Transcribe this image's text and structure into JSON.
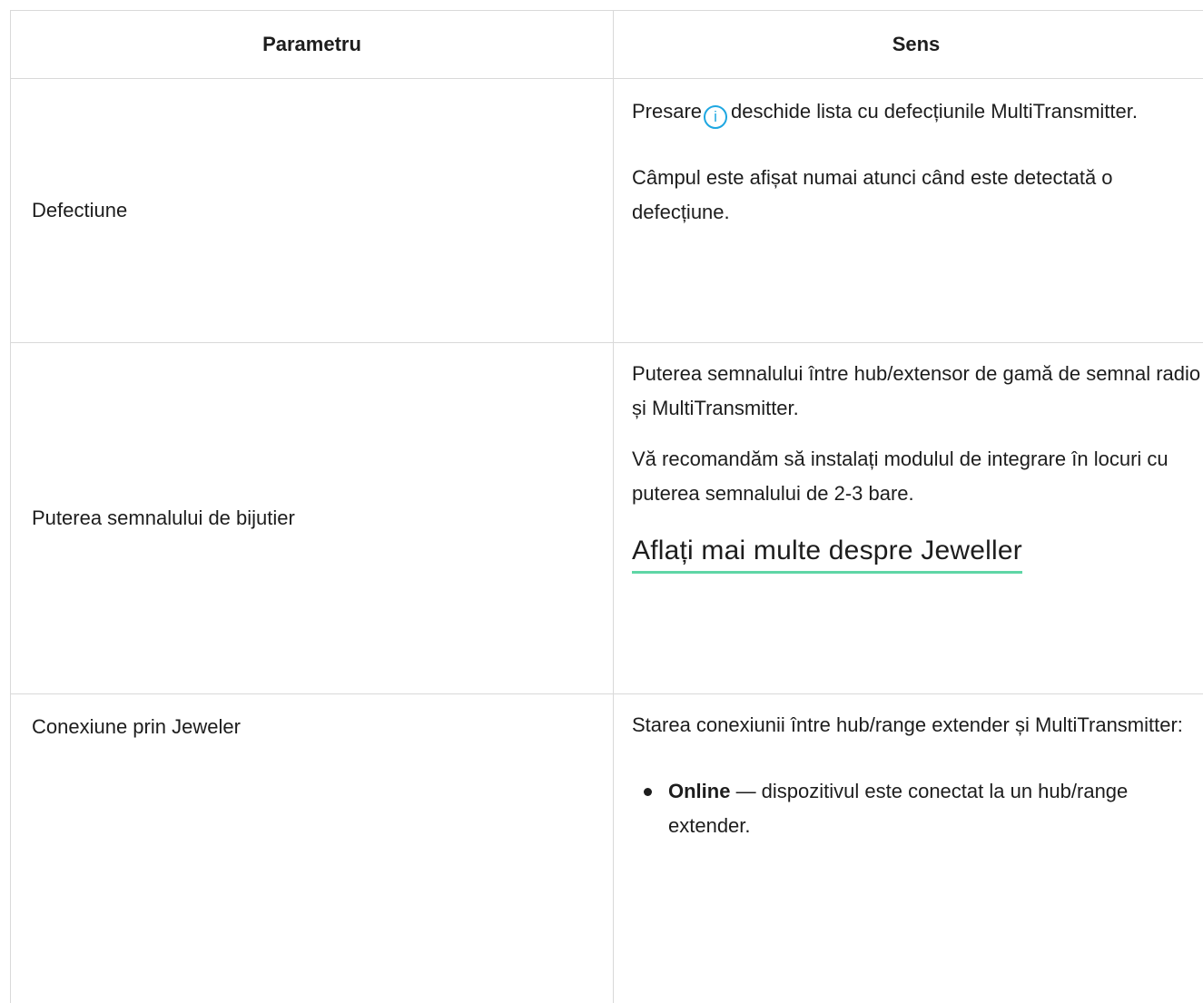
{
  "header": {
    "parameter": "Parametru",
    "meaning": "Sens"
  },
  "rows": [
    {
      "name": "Defectiune",
      "press_prefix": "Presare",
      "icon": "info-icon",
      "icon_glyph": "i",
      "press_suffix": "deschide lista cu defecțiunile MultiTransmitter.",
      "note": "Câmpul este afișat numai atunci când este detectată o defecțiune."
    },
    {
      "name": "Puterea semnalului de bijutier",
      "desc": "Puterea semnalului între hub/extensor de gamă de semnal radio și MultiTransmitter.",
      "recommend": "Vă recomandăm să instalați modulul de integrare în locuri cu puterea semnalului de 2-3 bare.",
      "link": "Aflați mai multe despre Jeweller"
    },
    {
      "name": "Conexiune prin Jeweler",
      "desc": "Starea conexiunii între hub/range extender și MultiTransmitter:",
      "items": [
        {
          "term": "Online",
          "text": " — dispozitivul este conectat la un hub/range extender."
        }
      ]
    }
  ],
  "colors": {
    "border": "#d9d9d9",
    "info_icon": "#1ea7e1",
    "link_underline": "#5fd6a6"
  }
}
